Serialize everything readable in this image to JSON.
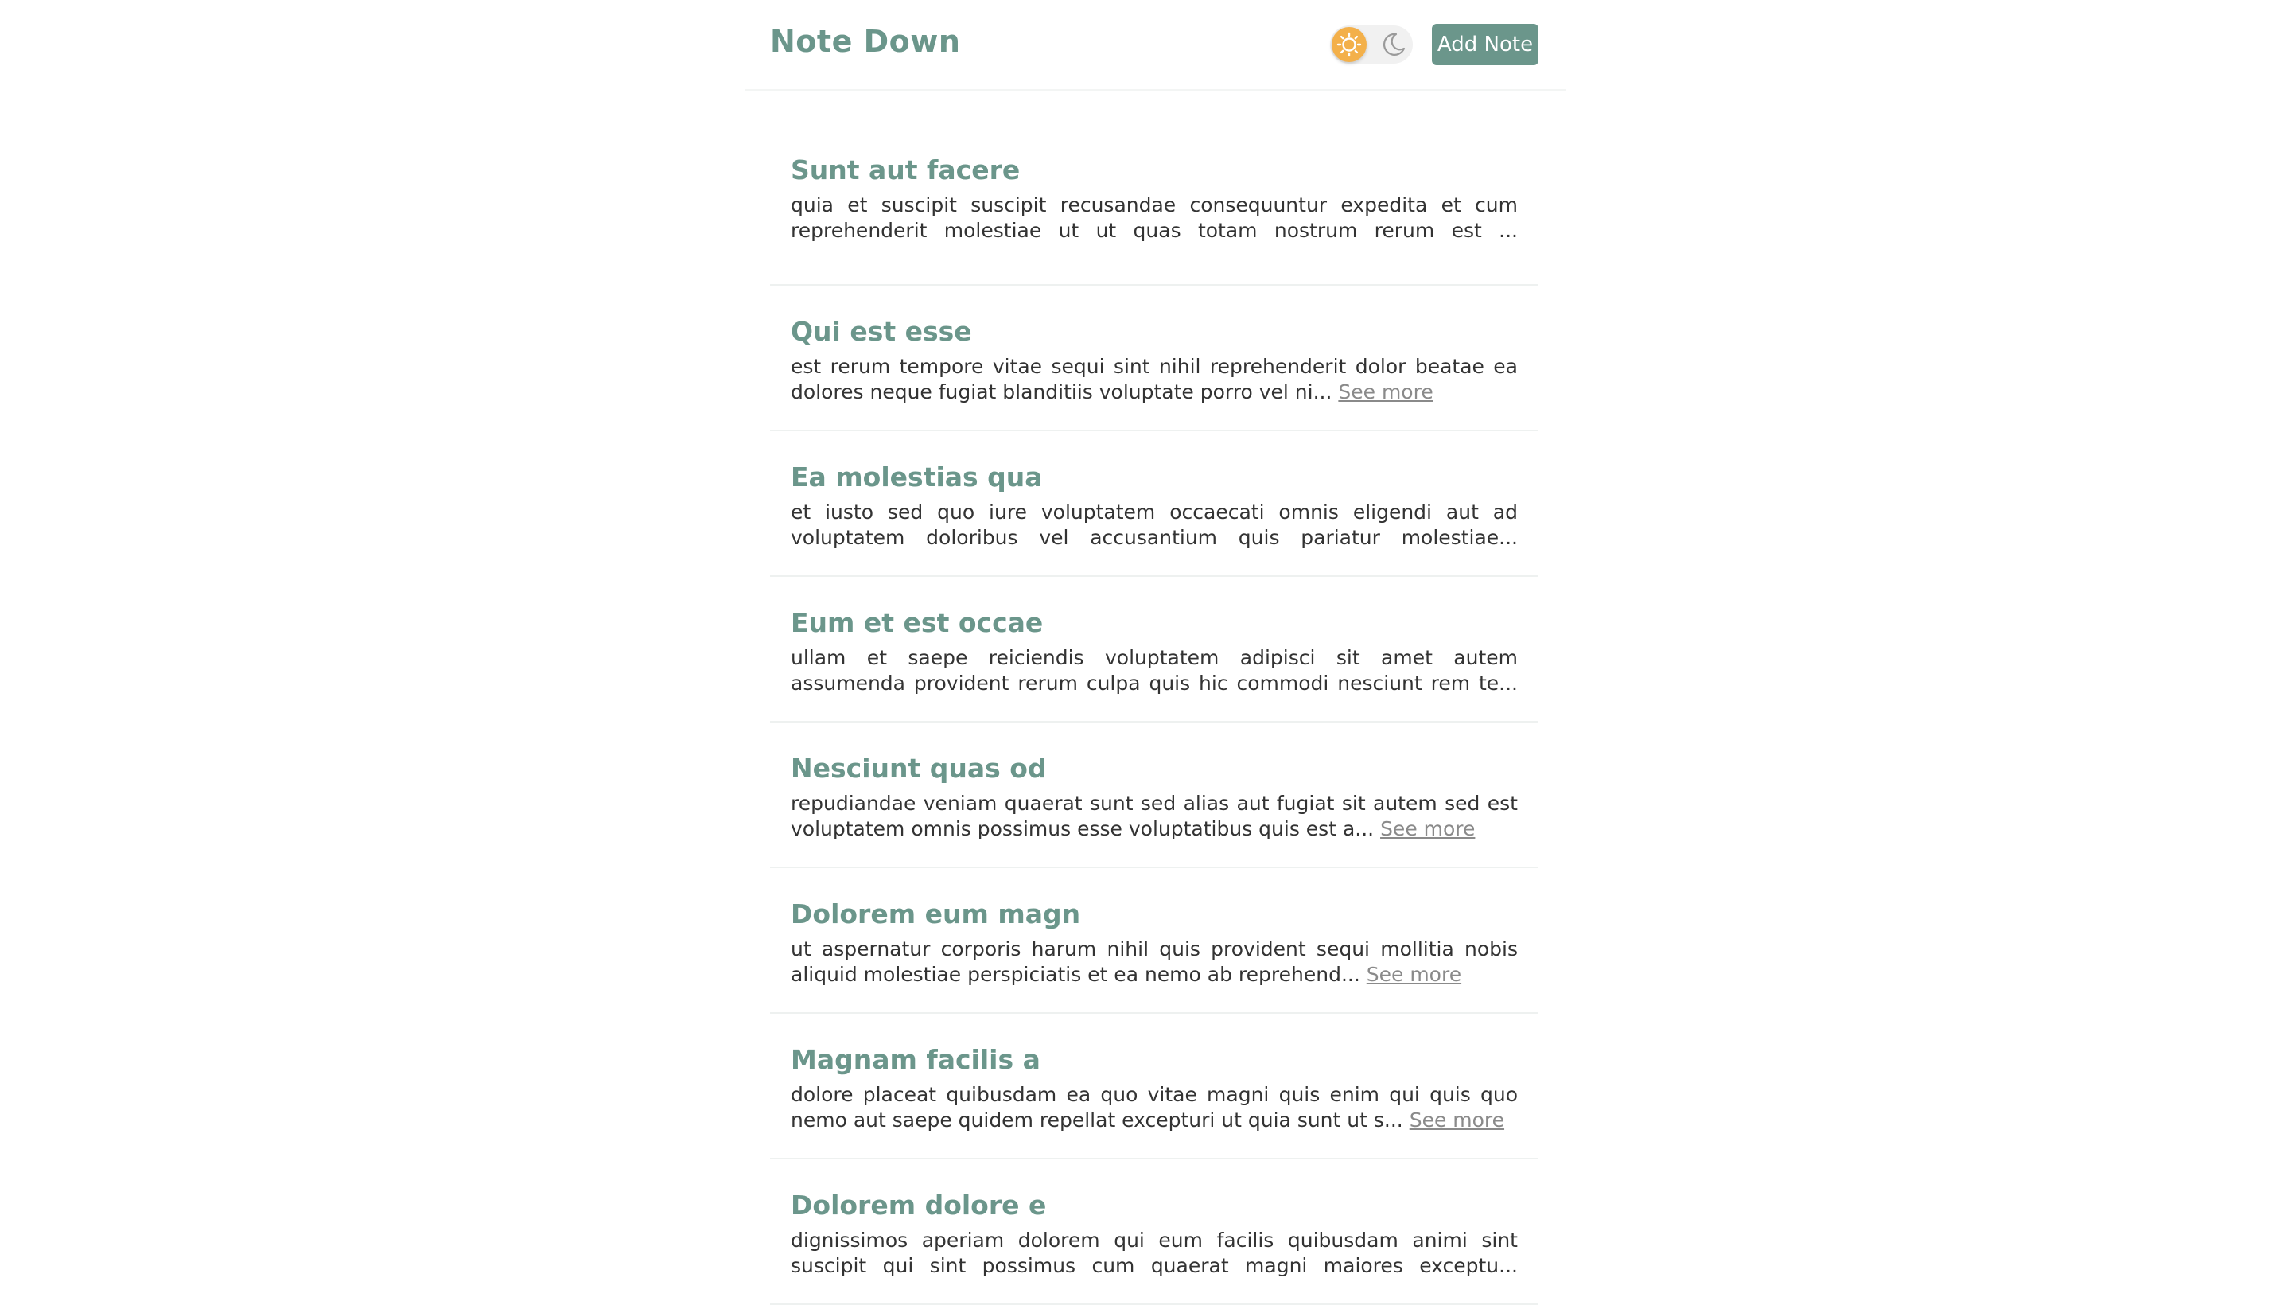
{
  "header": {
    "brand": "Note Down",
    "add_note_label": "Add Note"
  },
  "see_more_label": "See more",
  "notes": [
    {
      "title": "Sunt aut facere",
      "excerpt": "quia et suscipit suscipit recusandae consequuntur expedita et cum reprehenderit molestiae ut ut quas totam nostrum rerum est ..."
    },
    {
      "title": "Qui est esse",
      "excerpt": "est rerum tempore vitae sequi sint nihil reprehenderit dolor beatae ea dolores neque fugiat blanditiis voluptate porro vel ni..."
    },
    {
      "title": "Ea molestias qua",
      "excerpt": "et iusto sed quo iure voluptatem occaecati omnis eligendi aut ad voluptatem doloribus vel accusantium quis pariatur molestiae..."
    },
    {
      "title": "Eum et est occae",
      "excerpt": "ullam et saepe reiciendis voluptatem adipisci sit amet autem assumenda provident rerum culpa quis hic commodi nesciunt rem te..."
    },
    {
      "title": "Nesciunt quas od",
      "excerpt": "repudiandae veniam quaerat sunt sed alias aut fugiat sit autem sed est voluptatem omnis possimus esse voluptatibus quis est a..."
    },
    {
      "title": "Dolorem eum magn",
      "excerpt": "ut aspernatur corporis harum nihil quis provident sequi mollitia nobis aliquid molestiae perspiciatis et ea nemo ab reprehend..."
    },
    {
      "title": "Magnam facilis a",
      "excerpt": "dolore placeat quibusdam ea quo vitae magni quis enim qui quis quo nemo aut saepe quidem repellat excepturi ut quia sunt ut s..."
    },
    {
      "title": "Dolorem dolore e",
      "excerpt": "dignissimos aperiam dolorem qui eum facilis quibusdam animi sint suscipit qui sint possimus cum quaerat magni maiores exceptu..."
    }
  ],
  "colors": {
    "accent": "#6b968b",
    "sun": "#f3b04a",
    "link": "#8a8a8a",
    "text": "#333333"
  },
  "icons": {
    "light_mode": "sun-icon",
    "dark_mode": "moon-icon"
  }
}
